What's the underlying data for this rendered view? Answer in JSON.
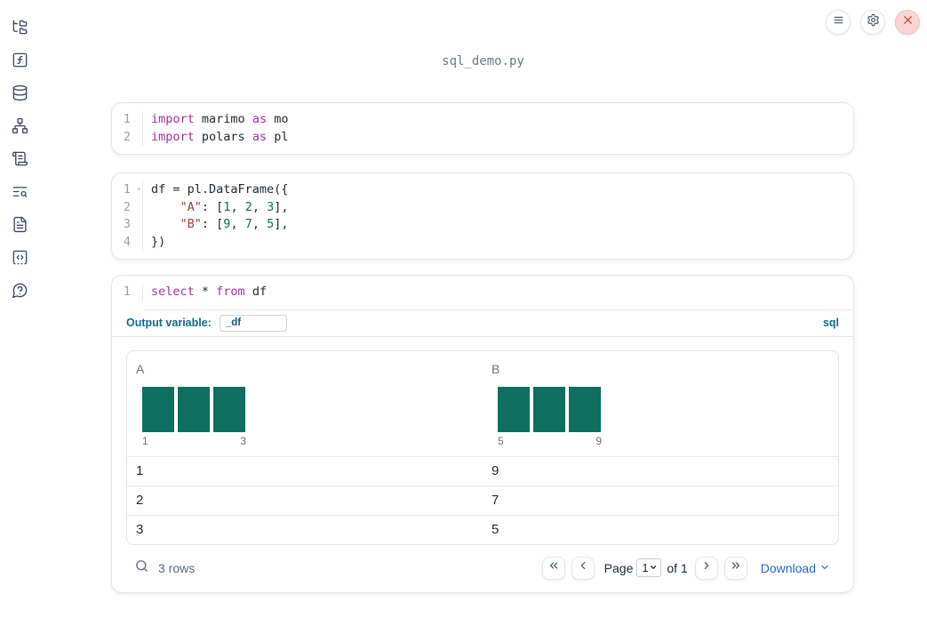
{
  "window": {
    "title": "sql_demo.py",
    "controls": {
      "menu": "menu-icon",
      "settings": "gear-icon",
      "close": "close-icon"
    }
  },
  "sidebar": {
    "items": [
      {
        "name": "file-explorer",
        "icon": "file-tree-icon"
      },
      {
        "name": "variables",
        "icon": "function-square-icon"
      },
      {
        "name": "data-sources",
        "icon": "database-icon"
      },
      {
        "name": "dependencies",
        "icon": "network-icon"
      },
      {
        "name": "logs",
        "icon": "scroll-text-icon"
      },
      {
        "name": "outline",
        "icon": "list-search-icon"
      },
      {
        "name": "documentation",
        "icon": "file-text-icon"
      },
      {
        "name": "snippets",
        "icon": "code-square-icon"
      },
      {
        "name": "help",
        "icon": "help-bubble-icon"
      }
    ]
  },
  "cells": [
    {
      "name": "imports-cell",
      "lines": [
        {
          "num": "1",
          "tokens": [
            [
              "import",
              "kw"
            ],
            [
              " marimo ",
              "pl"
            ],
            [
              "as",
              "kw"
            ],
            [
              " mo",
              "pl"
            ]
          ]
        },
        {
          "num": "2",
          "tokens": [
            [
              "import",
              "kw"
            ],
            [
              " polars ",
              "pl"
            ],
            [
              "as",
              "kw"
            ],
            [
              " pl",
              "pl"
            ]
          ]
        }
      ]
    },
    {
      "name": "dataframe-cell",
      "lines": [
        {
          "num": "1",
          "fold": true,
          "tokens": [
            [
              "df = pl.DataFrame({",
              "pl"
            ]
          ]
        },
        {
          "num": "2",
          "tokens": [
            [
              "    ",
              "pl"
            ],
            [
              "\"A\"",
              "str"
            ],
            [
              ": [",
              "pl"
            ],
            [
              "1",
              "num"
            ],
            [
              ", ",
              "pl"
            ],
            [
              "2",
              "num"
            ],
            [
              ", ",
              "pl"
            ],
            [
              "3",
              "num"
            ],
            [
              "],",
              "pl"
            ]
          ]
        },
        {
          "num": "3",
          "tokens": [
            [
              "    ",
              "pl"
            ],
            [
              "\"B\"",
              "str"
            ],
            [
              ": [",
              "pl"
            ],
            [
              "9",
              "num"
            ],
            [
              ", ",
              "pl"
            ],
            [
              "7",
              "num"
            ],
            [
              ", ",
              "pl"
            ],
            [
              "5",
              "num"
            ],
            [
              "],",
              "pl"
            ]
          ]
        },
        {
          "num": "4",
          "tokens": [
            [
              "})",
              "pl"
            ]
          ]
        }
      ]
    },
    {
      "name": "sql-cell",
      "lines": [
        {
          "num": "1",
          "tokens": [
            [
              "select",
              "kw"
            ],
            [
              " * ",
              "pl"
            ],
            [
              "from",
              "kw"
            ],
            [
              " df",
              "pl"
            ]
          ]
        }
      ],
      "output_variable_label": "Output variable:",
      "output_variable_value": "_df",
      "language_badge": "sql"
    }
  ],
  "table": {
    "columns": [
      {
        "name": "A",
        "histogram": {
          "bar_heights": [
            1,
            1,
            1
          ],
          "min_label": "1",
          "max_label": "3"
        }
      },
      {
        "name": "B",
        "histogram": {
          "bar_heights": [
            1,
            1,
            1
          ],
          "min_label": "5",
          "max_label": "9"
        }
      }
    ],
    "rows": [
      [
        "1",
        "9"
      ],
      [
        "2",
        "7"
      ],
      [
        "3",
        "5"
      ]
    ],
    "footer": {
      "row_count": "3 rows",
      "page_label": "Page",
      "page_value": "1",
      "of_label": "of 1",
      "download_label": "Download"
    }
  },
  "colors": {
    "accent_blue": "#0e6a96",
    "link_blue": "#2166d1",
    "histogram_teal": "#0e6e60",
    "close_red": "#d64545",
    "keyword": "#a42ea2",
    "string": "#a43c35",
    "number": "#116b4f",
    "sidebar_icon": "#3a4560"
  }
}
